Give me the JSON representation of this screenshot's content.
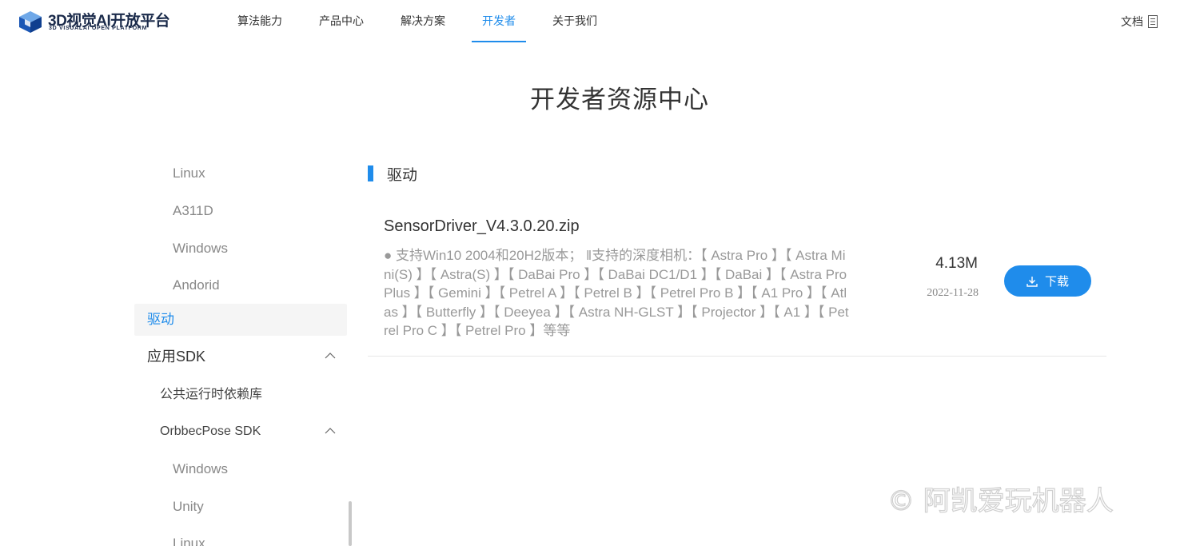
{
  "logo": {
    "title": "3D视觉AI开放平台",
    "subtitle": "3D VISUALAI OPEN PLATFORM"
  },
  "nav": [
    {
      "label": "算法能力"
    },
    {
      "label": "产品中心"
    },
    {
      "label": "解决方案"
    },
    {
      "label": "开发者"
    },
    {
      "label": "关于我们"
    }
  ],
  "docs_label": "文档",
  "page_title": "开发者资源中心",
  "sidebar": {
    "items": [
      {
        "label": "Linux"
      },
      {
        "label": "A311D"
      },
      {
        "label": "Windows"
      },
      {
        "label": "Andorid"
      },
      {
        "label": "驱动"
      },
      {
        "label": "应用SDK"
      },
      {
        "label": "公共运行时依赖库"
      },
      {
        "label": "OrbbecPose SDK"
      },
      {
        "label": "Windows"
      },
      {
        "label": "Unity"
      },
      {
        "label": "Linux"
      }
    ]
  },
  "section": {
    "title": "驱动"
  },
  "file": {
    "name": "SensorDriver_V4.3.0.20.zip",
    "description": "● 支持Win10 2004和20H2版本； ‖支持的深度相机：【 Astra Pro 】【 Astra Mini(S) 】【 Astra(S) 】【 DaBai Pro 】【 DaBai DC1/D1 】【 DaBai 】【 Astra Pro Plus 】【 Gemini 】【 Petrel A 】【 Petrel B 】【 Petrel Pro B 】【 A1 Pro 】【 Atlas 】【 Butterfly 】【 Deeyea 】【 Astra NH-GLST 】【 Projector 】【 A1 】【 Petrel Pro C 】【 Petrel Pro 】等等",
    "size": "4.13M",
    "date": "2022-11-28",
    "download_label": "下载"
  },
  "watermark": "© 阿凯爱玩机器人",
  "colors": {
    "accent": "#1f8ceb",
    "text": "#333333",
    "muted": "#999999"
  }
}
